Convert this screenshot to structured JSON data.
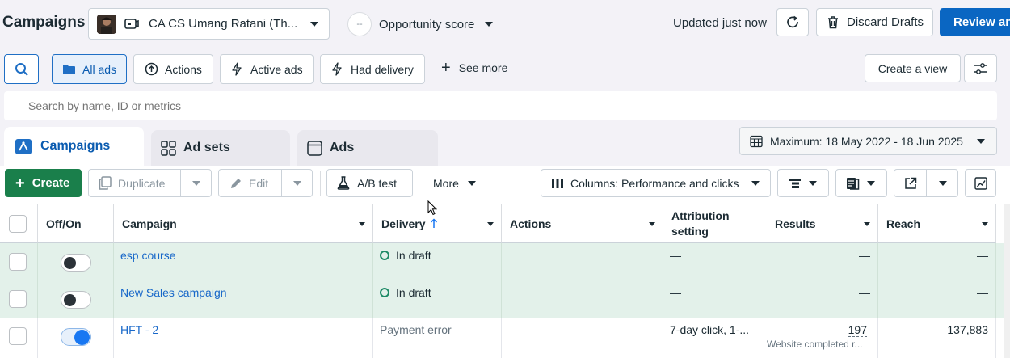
{
  "header": {
    "title": "Campaigns",
    "account_name": "CA CS Umang Ratani (Th...",
    "opportunity_placeholder": "--",
    "opportunity_label": "Opportunity score",
    "updated_text": "Updated just now",
    "discard_label": "Discard Drafts",
    "review_label": "Review and"
  },
  "filters": {
    "all_ads": "All ads",
    "actions": "Actions",
    "active_ads": "Active ads",
    "had_delivery": "Had delivery",
    "see_more": "See more",
    "create_view": "Create a view"
  },
  "search": {
    "placeholder": "Search by name, ID or metrics"
  },
  "tabs": [
    {
      "label": "Campaigns"
    },
    {
      "label": "Ad sets"
    },
    {
      "label": "Ads"
    }
  ],
  "date_range": "Maximum: 18 May 2022 - 18 Jun 2025",
  "toolbar": {
    "create": "Create",
    "duplicate": "Duplicate",
    "edit": "Edit",
    "ab_test": "A/B test",
    "more": "More",
    "columns": "Columns: Performance and clicks"
  },
  "table": {
    "headers": {
      "offon": "Off/On",
      "campaign": "Campaign",
      "delivery": "Delivery",
      "actions": "Actions",
      "attribution_1": "Attribution",
      "attribution_2": "setting",
      "results": "Results",
      "reach": "Reach"
    },
    "rows": [
      {
        "on": false,
        "campaign": "esp course",
        "delivery": "In draft",
        "actions": "",
        "attribution": "—",
        "results": "—",
        "results_sub": "",
        "reach": "—"
      },
      {
        "on": false,
        "campaign": "New Sales campaign",
        "delivery": "In draft",
        "actions": "",
        "attribution": "—",
        "results": "—",
        "results_sub": "",
        "reach": "—"
      },
      {
        "on": true,
        "campaign": "HFT - 2",
        "delivery": "Payment error",
        "actions": "—",
        "attribution": "7-day click, 1-...",
        "results": "197",
        "results_sub": "Website completed r...",
        "reach": "137,883"
      }
    ]
  },
  "colors": {
    "primary": "#0a66c2",
    "create_green": "#1a7f4b",
    "draft_row": "#e3f1ea",
    "link": "#1868c9"
  }
}
